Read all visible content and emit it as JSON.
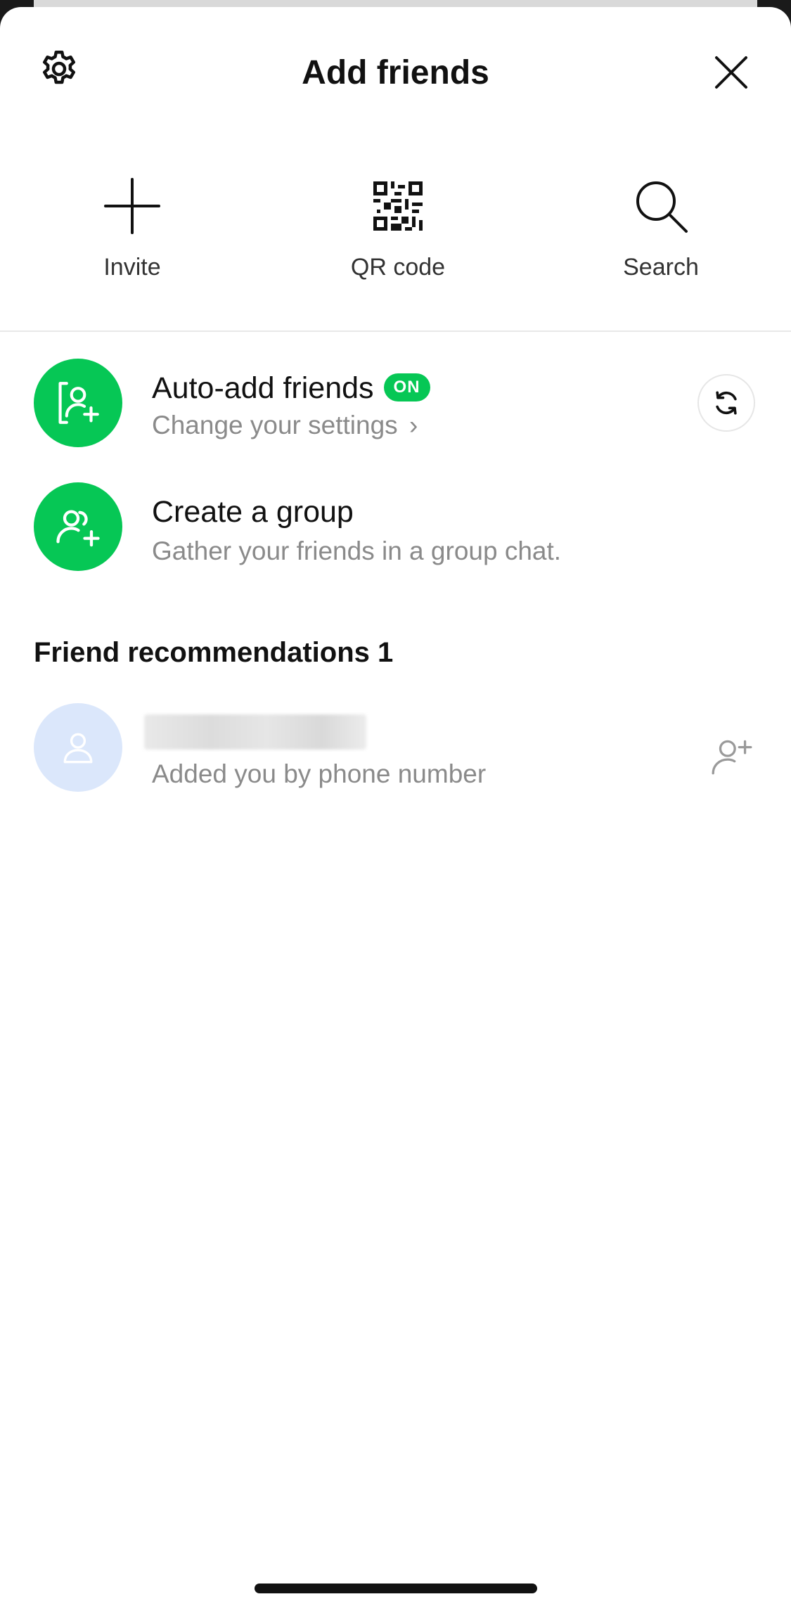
{
  "header": {
    "title": "Add friends",
    "settings_icon": "gear-icon",
    "close_icon": "close-icon"
  },
  "actions": [
    {
      "label": "Invite",
      "icon": "plus-icon"
    },
    {
      "label": "QR code",
      "icon": "qr-code-icon"
    },
    {
      "label": "Search",
      "icon": "search-icon"
    }
  ],
  "auto_add": {
    "title": "Auto-add friends",
    "badge": "ON",
    "subtitle": "Change your settings",
    "chevron": "›"
  },
  "create_group": {
    "title": "Create a group",
    "subtitle": "Gather your friends in a group chat."
  },
  "recommendations": {
    "title": "Friend recommendations 1",
    "items": [
      {
        "subtitle": "Added you by phone number"
      }
    ]
  },
  "colors": {
    "accent": "#06c755",
    "avatar_bg": "#dbe7fb"
  }
}
